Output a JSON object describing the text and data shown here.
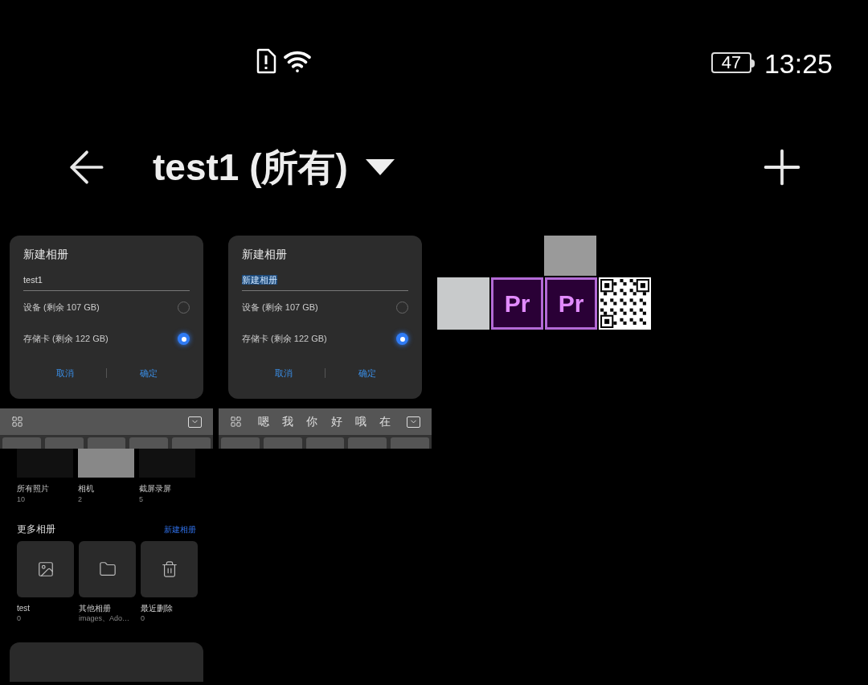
{
  "status_bar": {
    "battery": "47",
    "time": "13:25"
  },
  "header": {
    "title": "test1 (所有)"
  },
  "dialog_shots": [
    {
      "title": "新建相册",
      "input": {
        "value": "test1",
        "highlighted": false
      },
      "options": [
        {
          "label": "设备 (剩余 107 GB)",
          "selected": false
        },
        {
          "label": "存储卡 (剩余 122 GB)",
          "selected": true
        }
      ],
      "buttons": [
        "取消",
        "确定"
      ]
    },
    {
      "title": "新建相册",
      "input": {
        "value": "新建相册",
        "highlighted": true
      },
      "options": [
        {
          "label": "设备 (剩余 107 GB)",
          "selected": false
        },
        {
          "label": "存储卡 (剩余 122 GB)",
          "selected": true
        }
      ],
      "buttons": [
        "取消",
        "确定"
      ],
      "candidates": [
        "嗯",
        "我",
        "你",
        "好",
        "哦",
        "在"
      ]
    }
  ],
  "album_shot": {
    "albums": [
      {
        "name": "所有照片",
        "count": "10"
      },
      {
        "name": "相机",
        "count": "2"
      },
      {
        "name": "截屏录屏",
        "count": "5"
      }
    ],
    "section_title": "更多相册",
    "section_link": "新建相册",
    "more_albums": [
      {
        "kind": "image",
        "name": "test",
        "count": "0"
      },
      {
        "kind": "folder",
        "name": "其他相册",
        "count": "images、Ado…"
      },
      {
        "kind": "trash",
        "name": "最近删除",
        "count": "0"
      }
    ]
  },
  "tiles": [
    {
      "kind": "photo"
    },
    {
      "kind": "pr",
      "label": "Pr"
    },
    {
      "kind": "pr",
      "label": "Pr"
    },
    {
      "kind": "qr"
    }
  ]
}
